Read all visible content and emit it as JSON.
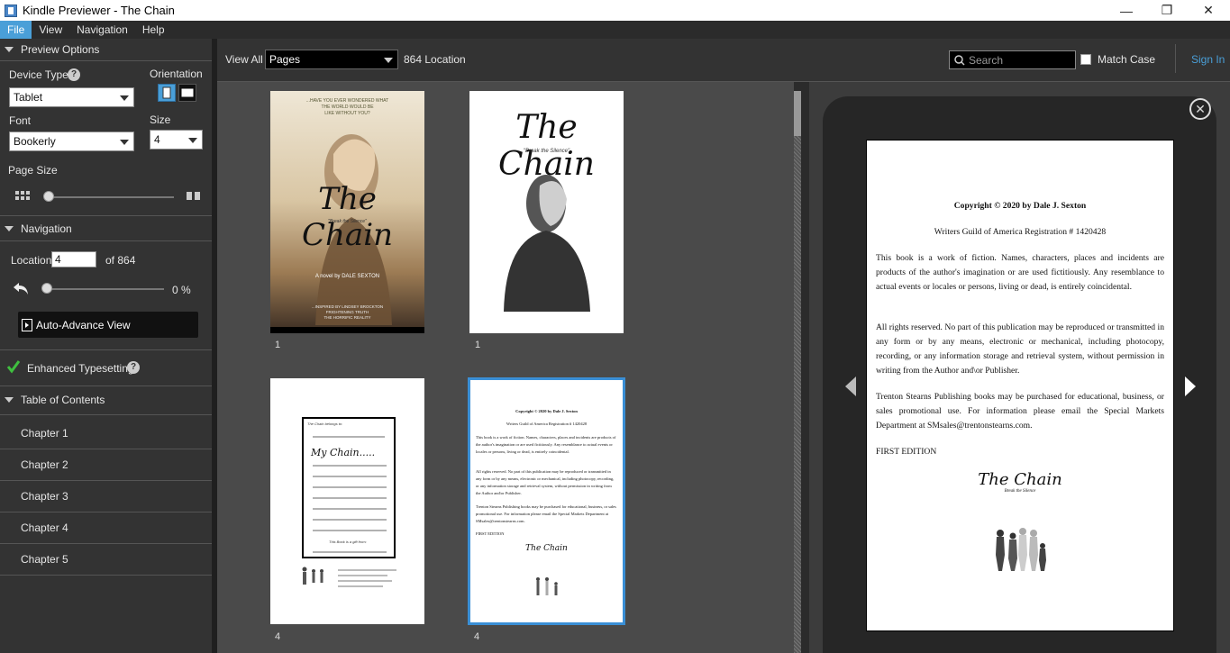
{
  "window": {
    "title": "Kindle Previewer - The Chain",
    "minimize": "—",
    "maximize": "❐",
    "close": "✕"
  },
  "menu": [
    "File",
    "View",
    "Navigation",
    "Help"
  ],
  "preview_options": {
    "header": "Preview Options",
    "device_type_label": "Device Type",
    "device_type_value": "Tablet",
    "orientation_label": "Orientation",
    "font_label": "Font",
    "font_value": "Bookerly",
    "size_label": "Size",
    "size_value": "4",
    "page_size_label": "Page Size"
  },
  "navigation": {
    "header": "Navigation",
    "location_label": "Location",
    "location_value": "4",
    "of_total": "of 864",
    "percent": "0 %",
    "progress_fraction": 0.0,
    "auto_advance": "Auto-Advance View"
  },
  "enhanced_typesetting": "Enhanced Typesetting",
  "toc": {
    "header": "Table of Contents",
    "items": [
      "Chapter 1",
      "Chapter 2",
      "Chapter 3",
      "Chapter 4",
      "Chapter 5"
    ]
  },
  "toolbar": {
    "view_all": "View All",
    "view_mode": "Pages",
    "locations": "864 Location",
    "search_placeholder": "Search",
    "match_case": "Match Case",
    "sign_in": "Sign In"
  },
  "thumbnails": [
    {
      "number": "1",
      "kind": "cover-color"
    },
    {
      "number": "1",
      "kind": "cover-bw"
    },
    {
      "number": "4",
      "kind": "journal"
    },
    {
      "number": "4",
      "kind": "copyright"
    }
  ],
  "cover": {
    "tagline_1": "...HAVE YOU EVER WONDERED WHAT",
    "tagline_2": "THE WORLD WOULD BE",
    "tagline_3": "LIKE WITHOUT YOU?",
    "title": "The Chain",
    "subtitle": "\"Break the Silence\"",
    "author": "A novel by DALE SEXTON",
    "blurb_1": "...INSPIRED BY LINDSEY BROCKTON",
    "blurb_2": "FRIGHTENING TRUTH",
    "blurb_3": "THE HORRIFIC REALITY"
  },
  "journal": {
    "heading": "My Chain.....",
    "top_note": "The Chain belongs to:",
    "bottom_note": "This Book is a gift from:"
  },
  "page": {
    "copyright": "Copyright © 2020 by Dale J. Sexton",
    "registration": "Writers Guild of America Registration # 1420428",
    "para1": "This book is a work of fiction. Names, characters, places and incidents are products of the author's imagination or are used fictitiously. Any resemblance to actual events or locales or persons, living or dead, is entirely coincidental.",
    "para2": "All rights reserved. No part of this publication may be reproduced or transmitted in any form or by any means, electronic or mechanical, including photocopy, recording, or any information storage and retrieval system, without permission in writing from the Author and\\or Publisher.",
    "para3": "Trenton Stearns Publishing books may be purchased for educational, business, or sales promotional use. For information please email the Special Markets Department at SMsales@trentonstearns.com.",
    "edition": "FIRST EDITION",
    "logo": "The Chain",
    "logo_sub": "Break the Silence"
  },
  "colors": {
    "accent": "#4a9fd8",
    "panel": "#333333",
    "thumb_bg": "#4a4a4a",
    "check": "#3fbf3f"
  }
}
